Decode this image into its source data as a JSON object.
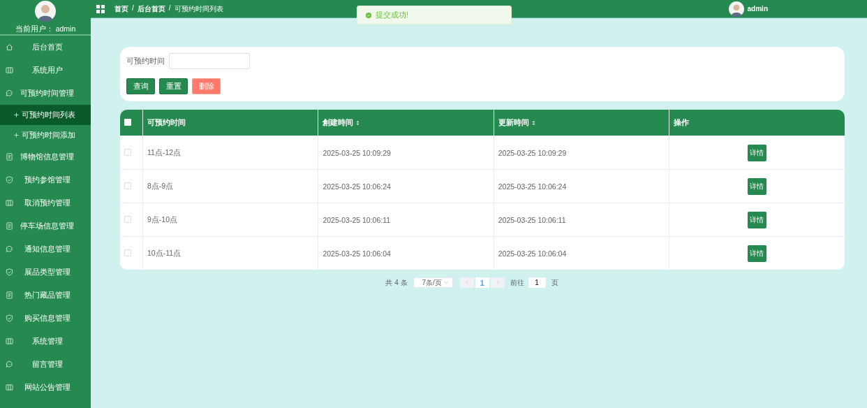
{
  "sidebar": {
    "current_user": "当前用户：  admin",
    "items": [
      {
        "label": "后台首页",
        "kind": "home",
        "selected": false
      },
      {
        "label": "系统用户",
        "kind": "columns",
        "selected": false
      },
      {
        "label": "可预约时间管理",
        "kind": "chat",
        "selected": false,
        "children": [
          {
            "label": "可预约时间列表",
            "selected": true
          },
          {
            "label": "可预约时间添加",
            "selected": false
          }
        ]
      },
      {
        "label": "博物馆信息管理",
        "kind": "doc",
        "selected": false
      },
      {
        "label": "预约参馆管理",
        "kind": "shield",
        "selected": false
      },
      {
        "label": "取消预约管理",
        "kind": "columns",
        "selected": false
      },
      {
        "label": "停车场信息管理",
        "kind": "doc",
        "selected": false
      },
      {
        "label": "通知信息管理",
        "kind": "chat",
        "selected": false
      },
      {
        "label": "展品类型管理",
        "kind": "shield",
        "selected": false
      },
      {
        "label": "热门藏品管理",
        "kind": "doc",
        "selected": false
      },
      {
        "label": "购买信息管理",
        "kind": "shield",
        "selected": false
      },
      {
        "label": "系统管理",
        "kind": "columns",
        "selected": false
      },
      {
        "label": "留言管理",
        "kind": "chat",
        "selected": false
      },
      {
        "label": "网站公告管理",
        "kind": "columns",
        "selected": false
      }
    ]
  },
  "topbar": {
    "breadcrumb": [
      "首页",
      "后台首页",
      "可预约时间列表"
    ],
    "separator": "/",
    "user": "admin"
  },
  "toast": {
    "message": "提交成功!"
  },
  "search": {
    "label": "可预约时间",
    "buttons": [
      {
        "label": "查询",
        "kind": "primary"
      },
      {
        "label": "重置",
        "kind": "primary"
      },
      {
        "label": "删除",
        "kind": "danger"
      }
    ]
  },
  "table": {
    "columns": [
      {
        "label": "可预约时间",
        "sortable": false
      },
      {
        "label": "創建時间",
        "sortable": true
      },
      {
        "label": "更新時间",
        "sortable": true
      },
      {
        "label": "操作",
        "sortable": false
      }
    ],
    "select_all_checked": false,
    "rows": [
      {
        "checked": false,
        "time": "11点-12点",
        "created": "2025-03-25 10:09:29",
        "updated": "2025-03-25 10:09:29",
        "action": "详情"
      },
      {
        "checked": false,
        "time": "8点-9点",
        "created": "2025-03-25 10:06:24",
        "updated": "2025-03-25 10:06:24",
        "action": "详情"
      },
      {
        "checked": false,
        "time": "9点-10点",
        "created": "2025-03-25 10:06:11",
        "updated": "2025-03-25 10:06:11",
        "action": "详情"
      },
      {
        "checked": false,
        "time": "10点-11点",
        "created": "2025-03-25 10:06:04",
        "updated": "2025-03-25 10:06:04",
        "action": "详情"
      }
    ]
  },
  "pagination": {
    "total": "共 4 条",
    "page_size": "7条/页",
    "pages": [
      {
        "label": "1",
        "selected": true
      }
    ],
    "goto_label": "前往",
    "goto_value": "1",
    "page_suffix": "页"
  }
}
